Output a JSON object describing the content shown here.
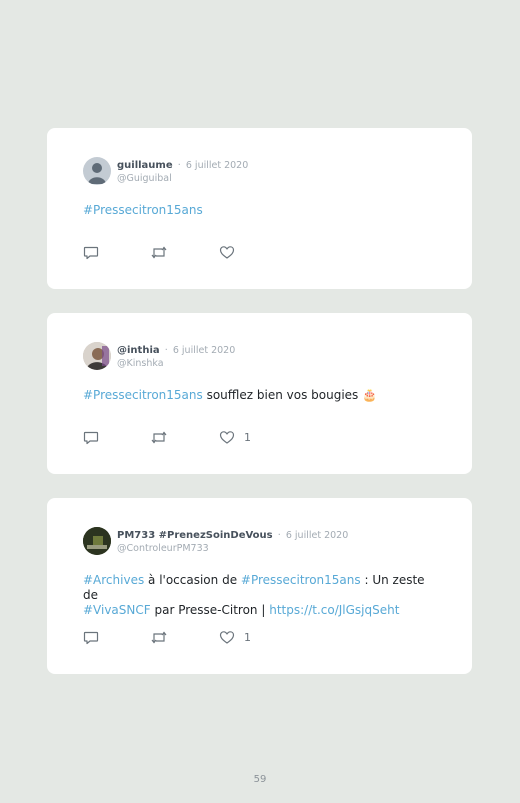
{
  "tweets": [
    {
      "author_name": "guillaume",
      "date": "6 juillet 2020",
      "handle": "@Guiguibal",
      "body": [
        {
          "text": "#Pressecitron15ans",
          "link": true
        }
      ],
      "like_count": ""
    },
    {
      "author_name": "@inthia",
      "date": "6 juillet 2020",
      "handle": "@Kinshka",
      "body": [
        {
          "text": "#Pressecitron15ans",
          "link": true
        },
        {
          "text": " soufflez bien vos bougies 🎂",
          "link": false
        }
      ],
      "like_count": "1"
    },
    {
      "author_name": "PM733 #PrenezSoinDeVous",
      "date": "6 juillet 2020",
      "handle": "@ControleurPM733",
      "body": [
        {
          "text": "#Archives",
          "link": true
        },
        {
          "text": " à l'occasion de ",
          "link": false
        },
        {
          "text": "#Pressecitron15ans",
          "link": true
        },
        {
          "text": " : Un zeste de ",
          "link": false
        },
        {
          "text": "#VivaSNCF",
          "link": true
        },
        {
          "text": " par Presse-Citron | ",
          "link": false
        },
        {
          "text": "https://t.co/JlGsjqSeht",
          "link": true
        }
      ],
      "like_count": "1"
    }
  ],
  "separator": "·",
  "page_number": "59",
  "colors": {
    "background": "#e4e8e4",
    "card": "#ffffff",
    "link": "#58a9d6",
    "icon": "#6b747c"
  },
  "icons": {
    "reply": "reply-icon",
    "retweet": "retweet-icon",
    "like": "heart-icon"
  }
}
